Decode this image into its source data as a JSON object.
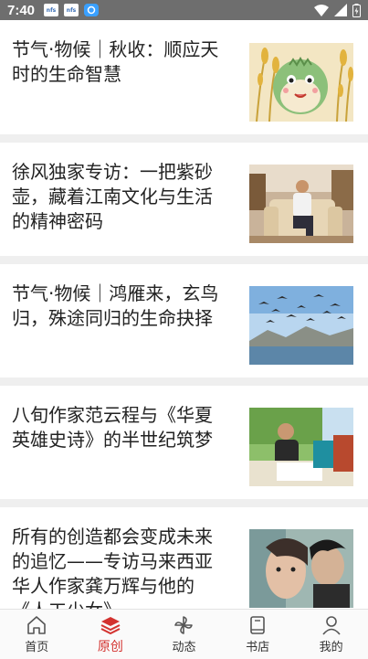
{
  "status": {
    "time": "7:40",
    "notif1": "nfs",
    "notif2": "nfs"
  },
  "articles": [
    {
      "title": "节气·物候｜秋收：顺应天时的生命智慧",
      "image": "illustration-cartoon-harvest"
    },
    {
      "title": "徐风独家专访：一把紫砂壶，藏着江南文化与生活的精神密码",
      "image": "man-seated-in-armchair"
    },
    {
      "title": "节气·物候｜鸿雁来，玄鸟归，殊途同归的生命抉择",
      "image": "geese-flying-over-lake"
    },
    {
      "title": "八旬作家范云程与《华夏英雄史诗》的半世纪筑梦",
      "image": "author-writing-at-desk"
    },
    {
      "title": "所有的创造都会变成未来的追忆——专访马来西亚华人作家龚万辉与他的《人工少女》",
      "image": "painted-girl-portrait"
    }
  ],
  "tabs": [
    {
      "label": "首页",
      "icon": "home-icon",
      "active": false
    },
    {
      "label": "原创",
      "icon": "layers-icon",
      "active": true
    },
    {
      "label": "动态",
      "icon": "pinwheel-icon",
      "active": false
    },
    {
      "label": "书店",
      "icon": "book-icon",
      "active": false
    },
    {
      "label": "我的",
      "icon": "person-icon",
      "active": false
    }
  ],
  "colors": {
    "accent": "#d3322f",
    "statusbar": "#6e6e6e",
    "text": "#222222"
  }
}
